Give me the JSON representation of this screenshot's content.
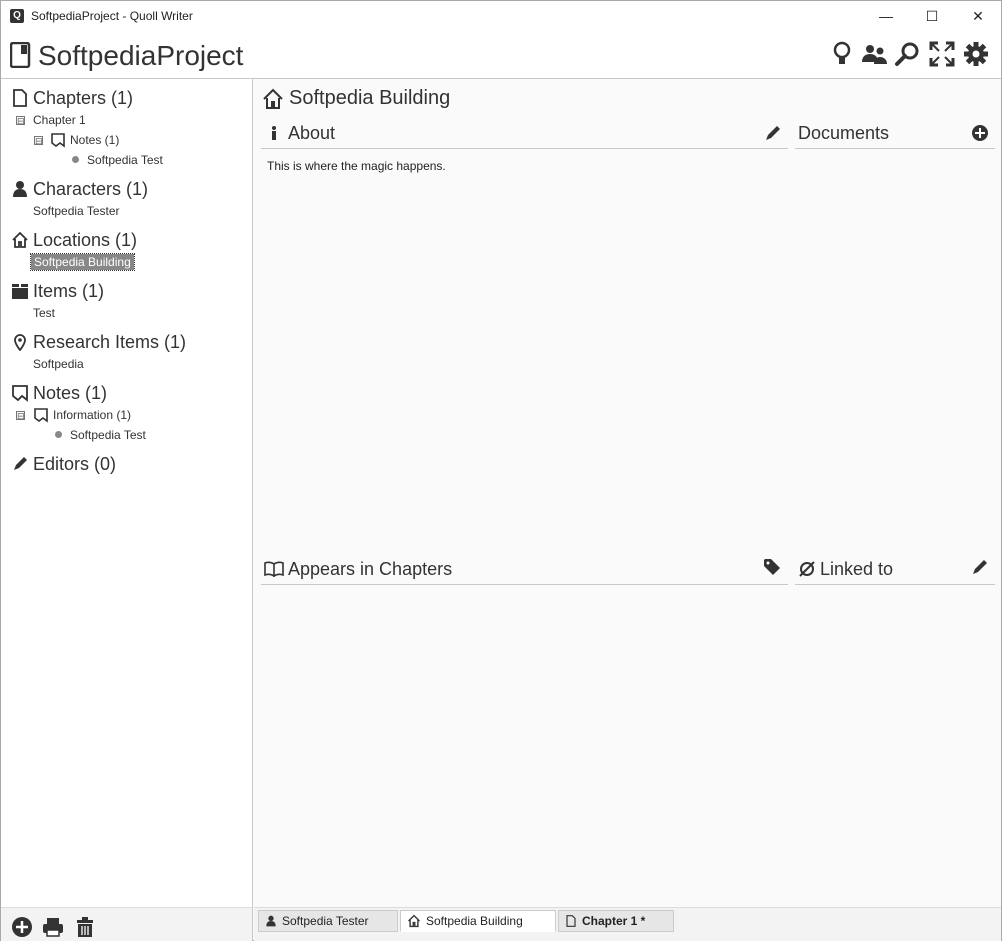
{
  "window": {
    "title": "SoftpediaProject - Quoll Writer",
    "app_icon_letter": "Q",
    "minimize": "—",
    "maximize": "☐",
    "close": "✕"
  },
  "header": {
    "project_title": "SoftpediaProject",
    "icons": [
      "lightbulb-icon",
      "contacts-icon",
      "search-icon",
      "fullscreen-icon",
      "settings-icon"
    ]
  },
  "sidebar": {
    "sections": [
      {
        "label": "Chapters (1)",
        "icon": "chapter-icon"
      },
      {
        "label": "Characters (1)",
        "icon": "character-icon"
      },
      {
        "label": "Locations (1)",
        "icon": "location-icon"
      },
      {
        "label": "Items (1)",
        "icon": "item-icon"
      },
      {
        "label": "Research Items (1)",
        "icon": "research-icon"
      },
      {
        "label": "Notes (1)",
        "icon": "notes-icon"
      },
      {
        "label": "Editors (0)",
        "icon": "editor-icon"
      }
    ],
    "chapters_tree": {
      "chapter": "Chapter 1",
      "notes": "Notes (1)",
      "note": "Softpedia Test"
    },
    "characters_item": "Softpedia Tester",
    "locations_item": "Softpedia Building",
    "items_item": "Test",
    "research_item": "Softpedia",
    "notes_tree": {
      "type": "Information (1)",
      "note": "Softpedia Test"
    },
    "toggle_symbol": "⊟"
  },
  "main": {
    "title": "Softpedia Building",
    "about": {
      "label": "About",
      "text": "This is where the magic happens."
    },
    "documents": {
      "label": "Documents"
    },
    "appears": {
      "label": "Appears in Chapters"
    },
    "linked": {
      "label": "Linked to"
    }
  },
  "tabs": [
    {
      "label": "Softpedia Tester",
      "icon": "character-icon"
    },
    {
      "label": "Softpedia Building",
      "icon": "location-icon"
    },
    {
      "label": "Chapter 1 *",
      "icon": "chapter-icon"
    }
  ],
  "footer_icons": [
    "add-icon",
    "print-icon",
    "trash-icon"
  ],
  "colors": {
    "selection": "#888888",
    "text": "#333333",
    "border": "#c8c8c8"
  }
}
